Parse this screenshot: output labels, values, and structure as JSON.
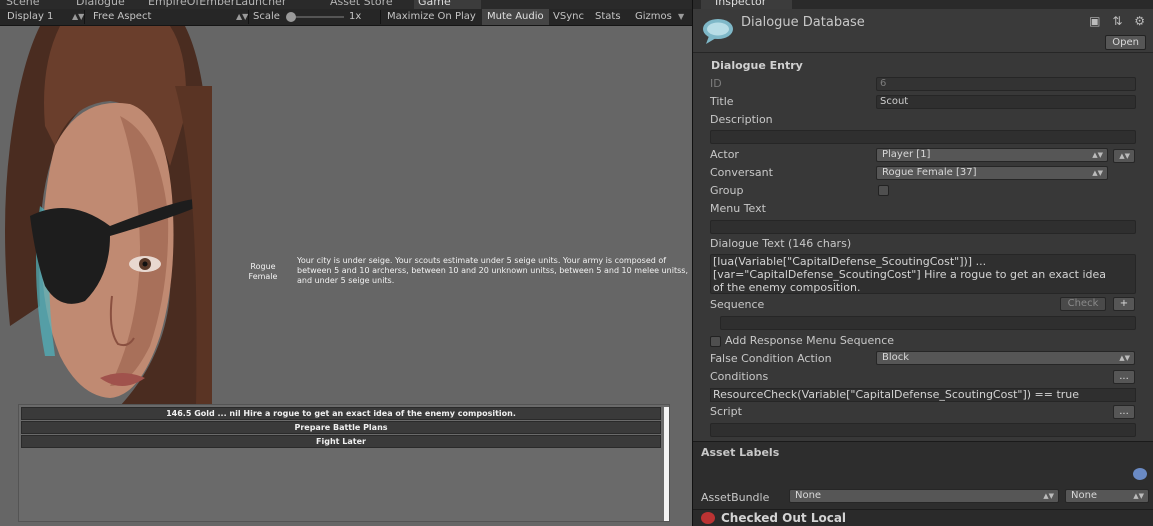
{
  "tabs": [
    "Scene",
    "Dialogue",
    "EmpireOfEmberLauncher",
    "Asset Store",
    "Game"
  ],
  "game_toolbar": {
    "display": "Display 1",
    "aspect": "Free Aspect",
    "scale_label": "Scale",
    "scale_value": "1x",
    "maximize": "Maximize On Play",
    "mute": "Mute Audio",
    "vsync": "VSync",
    "stats": "Stats",
    "gizmos": "Gizmos"
  },
  "game": {
    "npc_name_line1": "Rogue",
    "npc_name_line2": "Female",
    "npc_text": "Your city is under seige. Your scouts estimate under 5 seige units. Your army is composed of between 5 and 10 archerss, between 10 and 20 unknown unitss, between 5 and 10 melee unitss, and under 5 seige units.",
    "responses": [
      "146.5 Gold ... nil Hire a rogue to get an exact idea of the enemy composition.",
      "Prepare Battle Plans",
      "Fight Later"
    ]
  },
  "inspector": {
    "tab": "Inspector",
    "title": "Dialogue Database",
    "open": "Open",
    "section": "Dialogue Entry",
    "id_label": "ID",
    "id_value": "6",
    "title_label": "Title",
    "title_value": "Scout",
    "description_label": "Description",
    "description_value": "",
    "actor_label": "Actor",
    "actor_value": "Player [1]",
    "conversant_label": "Conversant",
    "conversant_value": "Rogue Female [37]",
    "group_label": "Group",
    "menu_text_label": "Menu Text",
    "menu_text_value": "",
    "dialogue_text_label": "Dialogue Text (146 chars)",
    "dialogue_text_line1": "[lua(Variable[\"CapitalDefense_ScoutingCost\"])] ...",
    "dialogue_text_line2": "[var=\"CapitalDefense_ScoutingCost\"] Hire a rogue to get an exact idea",
    "dialogue_text_line3": "of the enemy composition.",
    "sequence_label": "Sequence",
    "check_button": "Check",
    "plus_button": "+",
    "add_response_label": "Add Response Menu Sequence",
    "false_condition_label": "False Condition Action",
    "false_condition_value": "Block",
    "conditions_label": "Conditions",
    "conditions_value": "ResourceCheck(Variable[\"CapitalDefense_ScoutingCost\"])  == true",
    "script_label": "Script",
    "ellipsis": "..."
  },
  "asset_labels": {
    "title": "Asset Labels",
    "assetbundle_label": "AssetBundle",
    "assetbundle_value": "None",
    "variant_value": "None"
  },
  "checked_out": "Checked Out Local"
}
